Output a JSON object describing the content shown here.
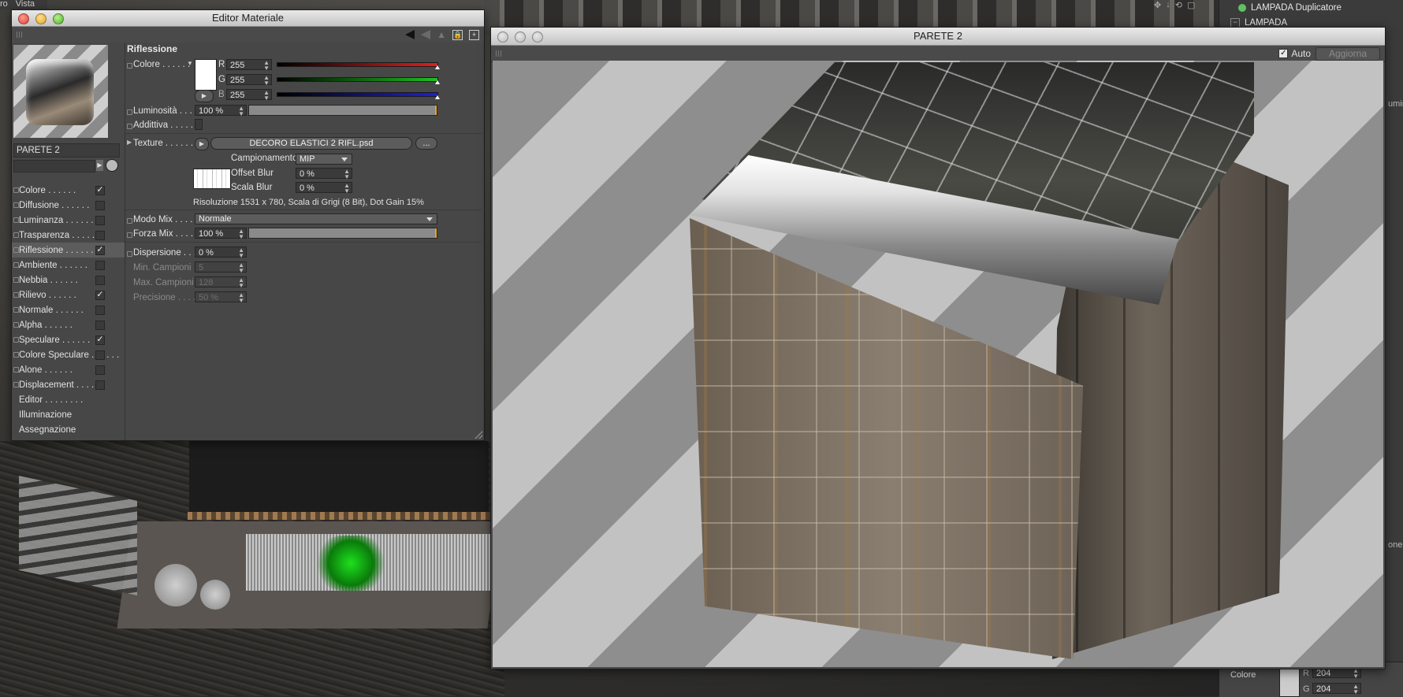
{
  "menubar": {
    "items": [
      "ro",
      "Vista"
    ]
  },
  "object_manager": {
    "items": [
      "LAMPADA Duplicatore",
      "LAMPADA"
    ],
    "fragments": [
      "umin",
      "one"
    ],
    "lower_panel": {
      "label": "Colore",
      "r_label": "R",
      "r_value": "204",
      "g_label": "G",
      "g_value": "204"
    }
  },
  "material_editor": {
    "title": "Editor Materiale",
    "material_name": "PARETE 2",
    "channels": [
      {
        "label": "Colore",
        "checked": true
      },
      {
        "label": "Diffusione",
        "checked": false
      },
      {
        "label": "Luminanza",
        "checked": false
      },
      {
        "label": "Trasparenza",
        "checked": false
      },
      {
        "label": "Riflessione",
        "checked": true,
        "selected": true
      },
      {
        "label": "Ambiente",
        "checked": false
      },
      {
        "label": "Nebbia",
        "checked": false
      },
      {
        "label": "Rilievo",
        "checked": true
      },
      {
        "label": "Normale",
        "checked": false
      },
      {
        "label": "Alpha",
        "checked": false
      },
      {
        "label": "Speculare",
        "checked": true
      },
      {
        "label": "Colore Speculare",
        "checked": false
      },
      {
        "label": "Alone",
        "checked": false
      },
      {
        "label": "Displacement",
        "checked": false
      }
    ],
    "extra_items": [
      "Editor",
      "Illuminazione",
      "Assegnazione"
    ],
    "section_title": "Riflessione",
    "color": {
      "label": "Colore",
      "r_label": "R",
      "r": "255",
      "g_label": "G",
      "g": "255",
      "b_label": "B",
      "b": "255",
      "swatch": "#ffffff"
    },
    "brightness": {
      "label": "Luminosità",
      "value": "100 %",
      "percent": 100
    },
    "additive": {
      "label": "Addittiva",
      "checked": false
    },
    "texture": {
      "label": "Texture",
      "file": "DECORO ELASTICI 2 RIFL.psd",
      "more_label": "...",
      "sampling_label": "Campionamento",
      "sampling_value": "MIP",
      "offset_blur_label": "Offset Blur",
      "offset_blur_value": "0 %",
      "scale_blur_label": "Scala Blur",
      "scale_blur_value": "0 %",
      "info": "Risoluzione 1531 x 780, Scala di Grigi (8 Bit), Dot Gain 15%"
    },
    "mix_mode": {
      "label": "Modo Mix",
      "value": "Normale"
    },
    "mix_strength": {
      "label": "Forza Mix",
      "value": "100 %",
      "percent": 100
    },
    "dispersion": {
      "label": "Dispersione",
      "value": "0 %"
    },
    "min_samples": {
      "label": "Min. Campioni",
      "value": "5"
    },
    "max_samples": {
      "label": "Max. Campioni",
      "value": "128"
    },
    "precision": {
      "label": "Precisione",
      "value": "50 %"
    }
  },
  "render_window": {
    "title": "PARETE 2",
    "auto_label": "Auto",
    "auto_checked": true,
    "refresh_label": "Aggiorna"
  },
  "colors": {
    "red_slider": "#e02020",
    "green_slider": "#20c020",
    "blue_slider": "#2020d0",
    "accent_orange": "#e8a020"
  }
}
